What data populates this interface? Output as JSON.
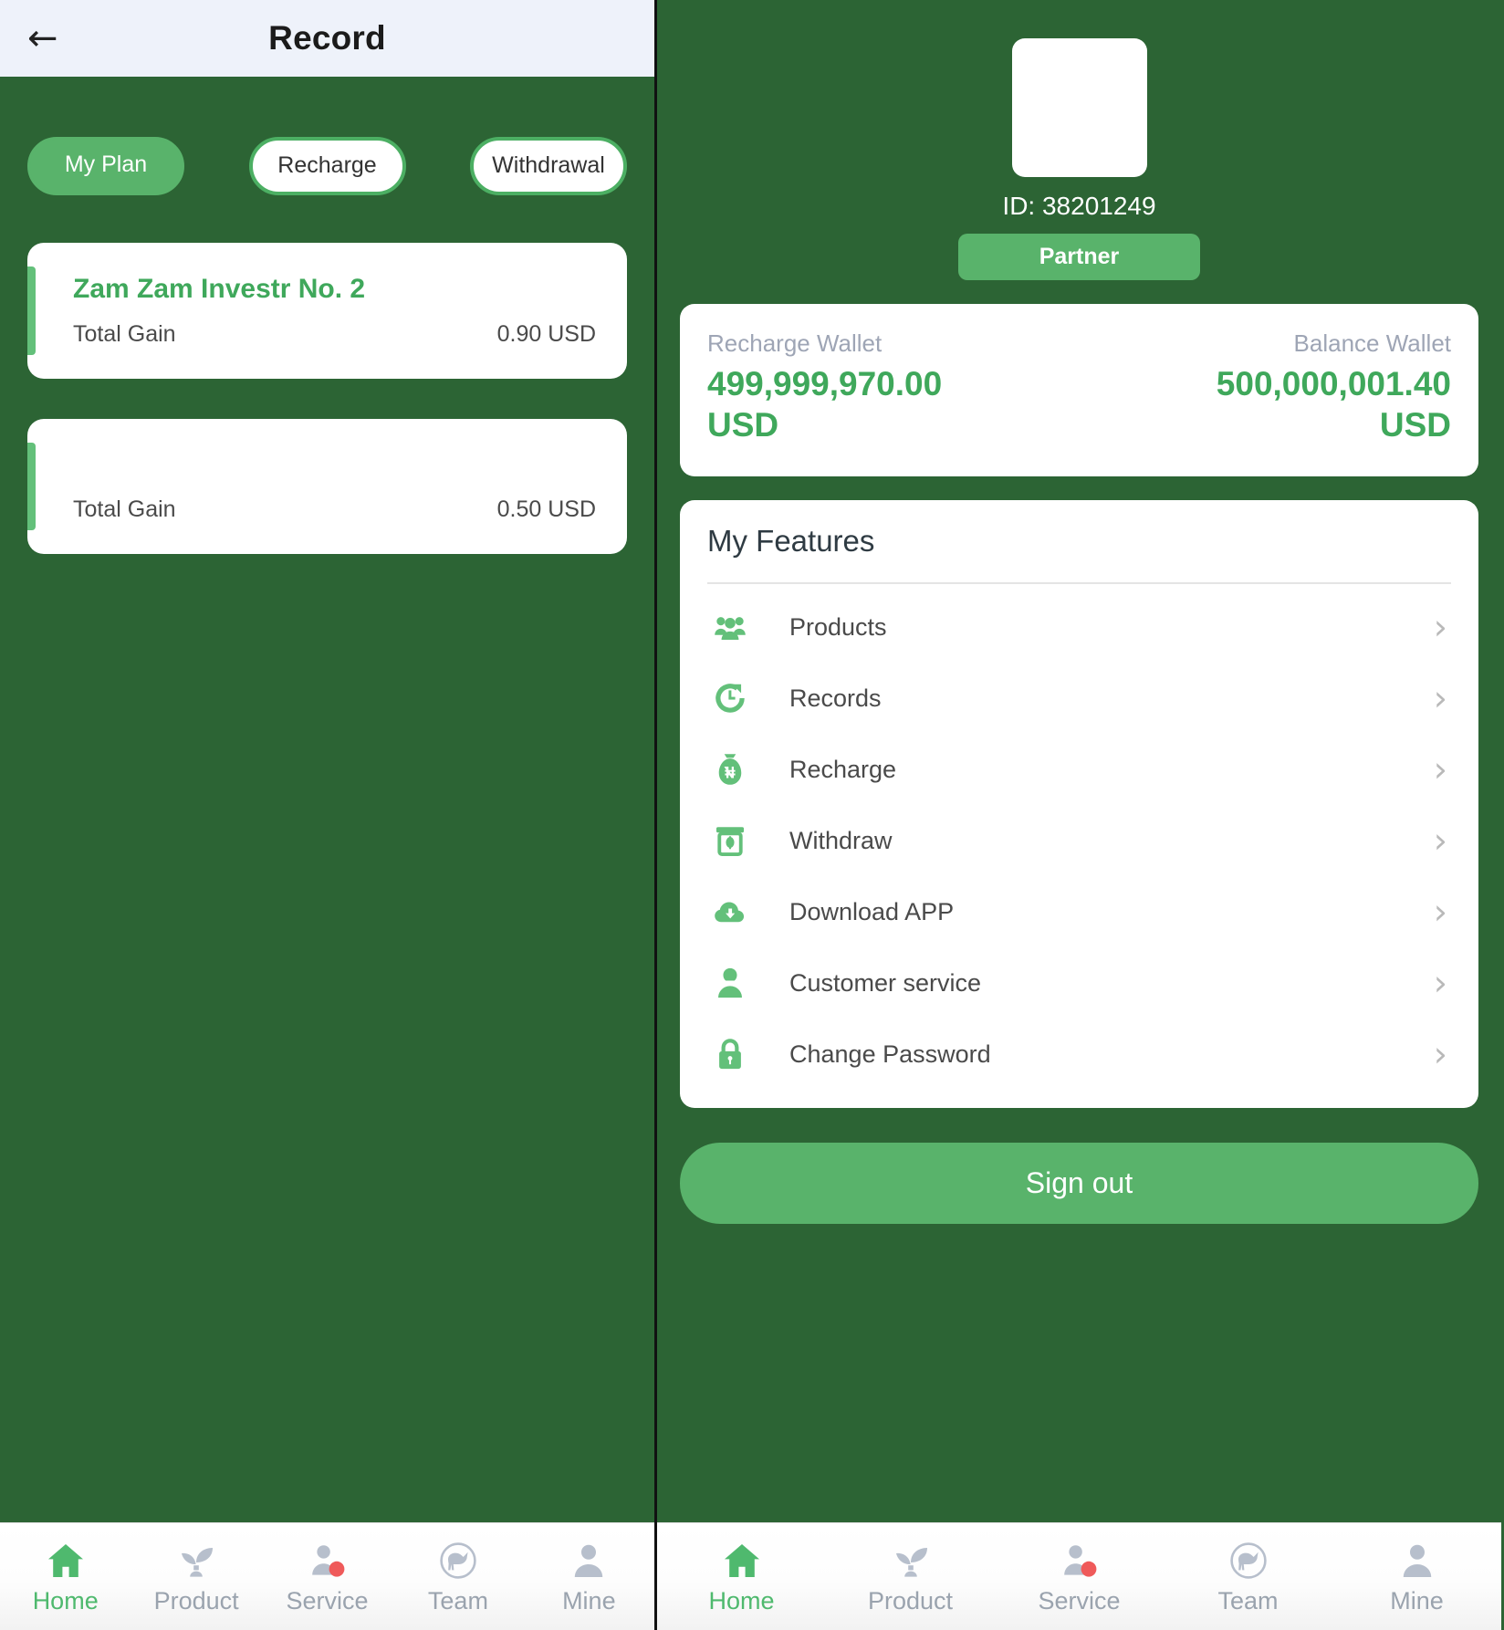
{
  "left": {
    "header": {
      "title": "Record",
      "back_icon": "arrow-left-icon"
    },
    "tabs": [
      {
        "label": "My Plan",
        "active": true
      },
      {
        "label": "Recharge",
        "active": false
      },
      {
        "label": "Withdrawal",
        "active": false
      }
    ],
    "records": [
      {
        "title": "Zam Zam Investr No. 2",
        "label": "Total Gain",
        "value": "0.90 USD"
      },
      {
        "title": "",
        "label": "Total Gain",
        "value": "0.50 USD"
      }
    ]
  },
  "right": {
    "profile": {
      "avatar_icon": "avatar-placeholder",
      "user_id": "ID: 38201249",
      "rank_badge": "Partner"
    },
    "wallets": [
      {
        "name": "Recharge Wallet",
        "amount": "499,999,970.00 USD"
      },
      {
        "name": "Balance Wallet",
        "amount": "500,000,001.40 USD"
      }
    ],
    "features": {
      "title": "My Features",
      "items": [
        {
          "label": "Products",
          "icon": "group-people-icon",
          "chevron": "›"
        },
        {
          "label": "Records",
          "icon": "history-clock-icon",
          "chevron": "›"
        },
        {
          "label": "Recharge",
          "icon": "money-bag-icon",
          "chevron": "›"
        },
        {
          "label": "Withdraw",
          "icon": "atm-machine-icon",
          "chevron": "›"
        },
        {
          "label": "Download APP",
          "icon": "cloud-download-icon",
          "chevron": "›"
        },
        {
          "label": "Customer service",
          "icon": "person-support-icon",
          "chevron": "›"
        },
        {
          "label": "Change Password",
          "icon": "lock-icon",
          "chevron": "›"
        }
      ]
    },
    "signout_label": "Sign out"
  },
  "bottom_nav": {
    "items": [
      {
        "label": "Home",
        "icon": "home-icon",
        "active": true
      },
      {
        "label": "Product",
        "icon": "plant-icon",
        "active": false
      },
      {
        "label": "Service",
        "icon": "support-person-icon",
        "active": false
      },
      {
        "label": "Team",
        "icon": "team-bird-icon",
        "active": false
      },
      {
        "label": "Mine",
        "icon": "user-profile-icon",
        "active": false
      }
    ]
  },
  "colors": {
    "dark_green_bg": "#2c6434",
    "accent_green": "#59b36b",
    "value_green": "#3fa85b",
    "icon_green": "#63c07a",
    "header_bg": "#eef2fa",
    "muted_text": "#9aa3ae",
    "nav_active": "#4fb96e",
    "service_badge_red": "#ef5a5a"
  }
}
